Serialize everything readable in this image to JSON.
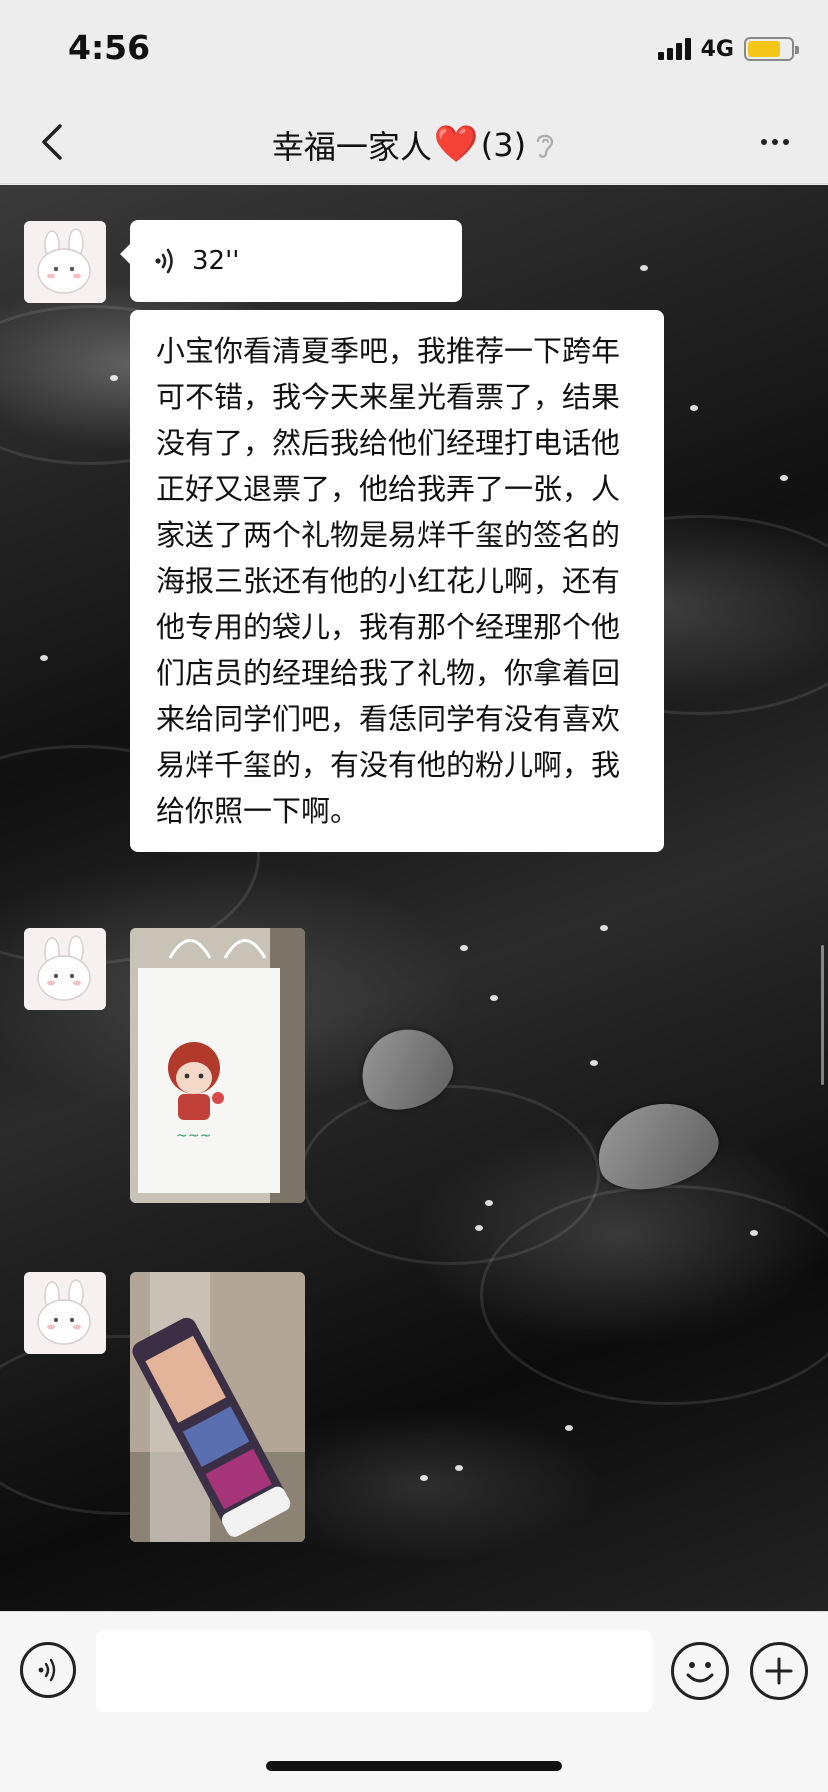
{
  "status_bar": {
    "time": "4:56",
    "network": "4G",
    "battery_level": 0.75,
    "battery_color": "#f5c518",
    "signal_icon": "signal-bars-icon"
  },
  "header": {
    "back_icon": "chevron-left-icon",
    "title": "幸福一家人",
    "title_emoji": "❤️",
    "member_count": "(3)",
    "earpiece_icon": "ear-icon",
    "more_icon": "more-dots-icon"
  },
  "messages": [
    {
      "type": "voice",
      "duration": "32''",
      "icon": "voice-wave-icon"
    },
    {
      "type": "text",
      "text": "小宝你看清夏季吧，我推荐一下跨年可不错，我今天来星光看票了，结果没有了，然后我给他们经理打电话他正好又退票了，他给我弄了一张，人家送了两个礼物是易烊千玺的签名的海报三张还有他的小红花儿啊，还有他专用的袋儿，我有那个经理那个他们店员的经理给我了礼物，你拿着回来给同学们吧，看恁同学有没有喜欢易烊千玺的，有没有他的粉儿啊，我给你照一下啊。"
    },
    {
      "type": "image",
      "subject": "white-gift-bag-photo"
    },
    {
      "type": "image",
      "subject": "poster-tube-photo"
    }
  ],
  "input_bar": {
    "voice_icon": "voice-mode-icon",
    "input_value": "",
    "emoji_icon": "emoji-icon",
    "plus_icon": "plus-icon"
  }
}
